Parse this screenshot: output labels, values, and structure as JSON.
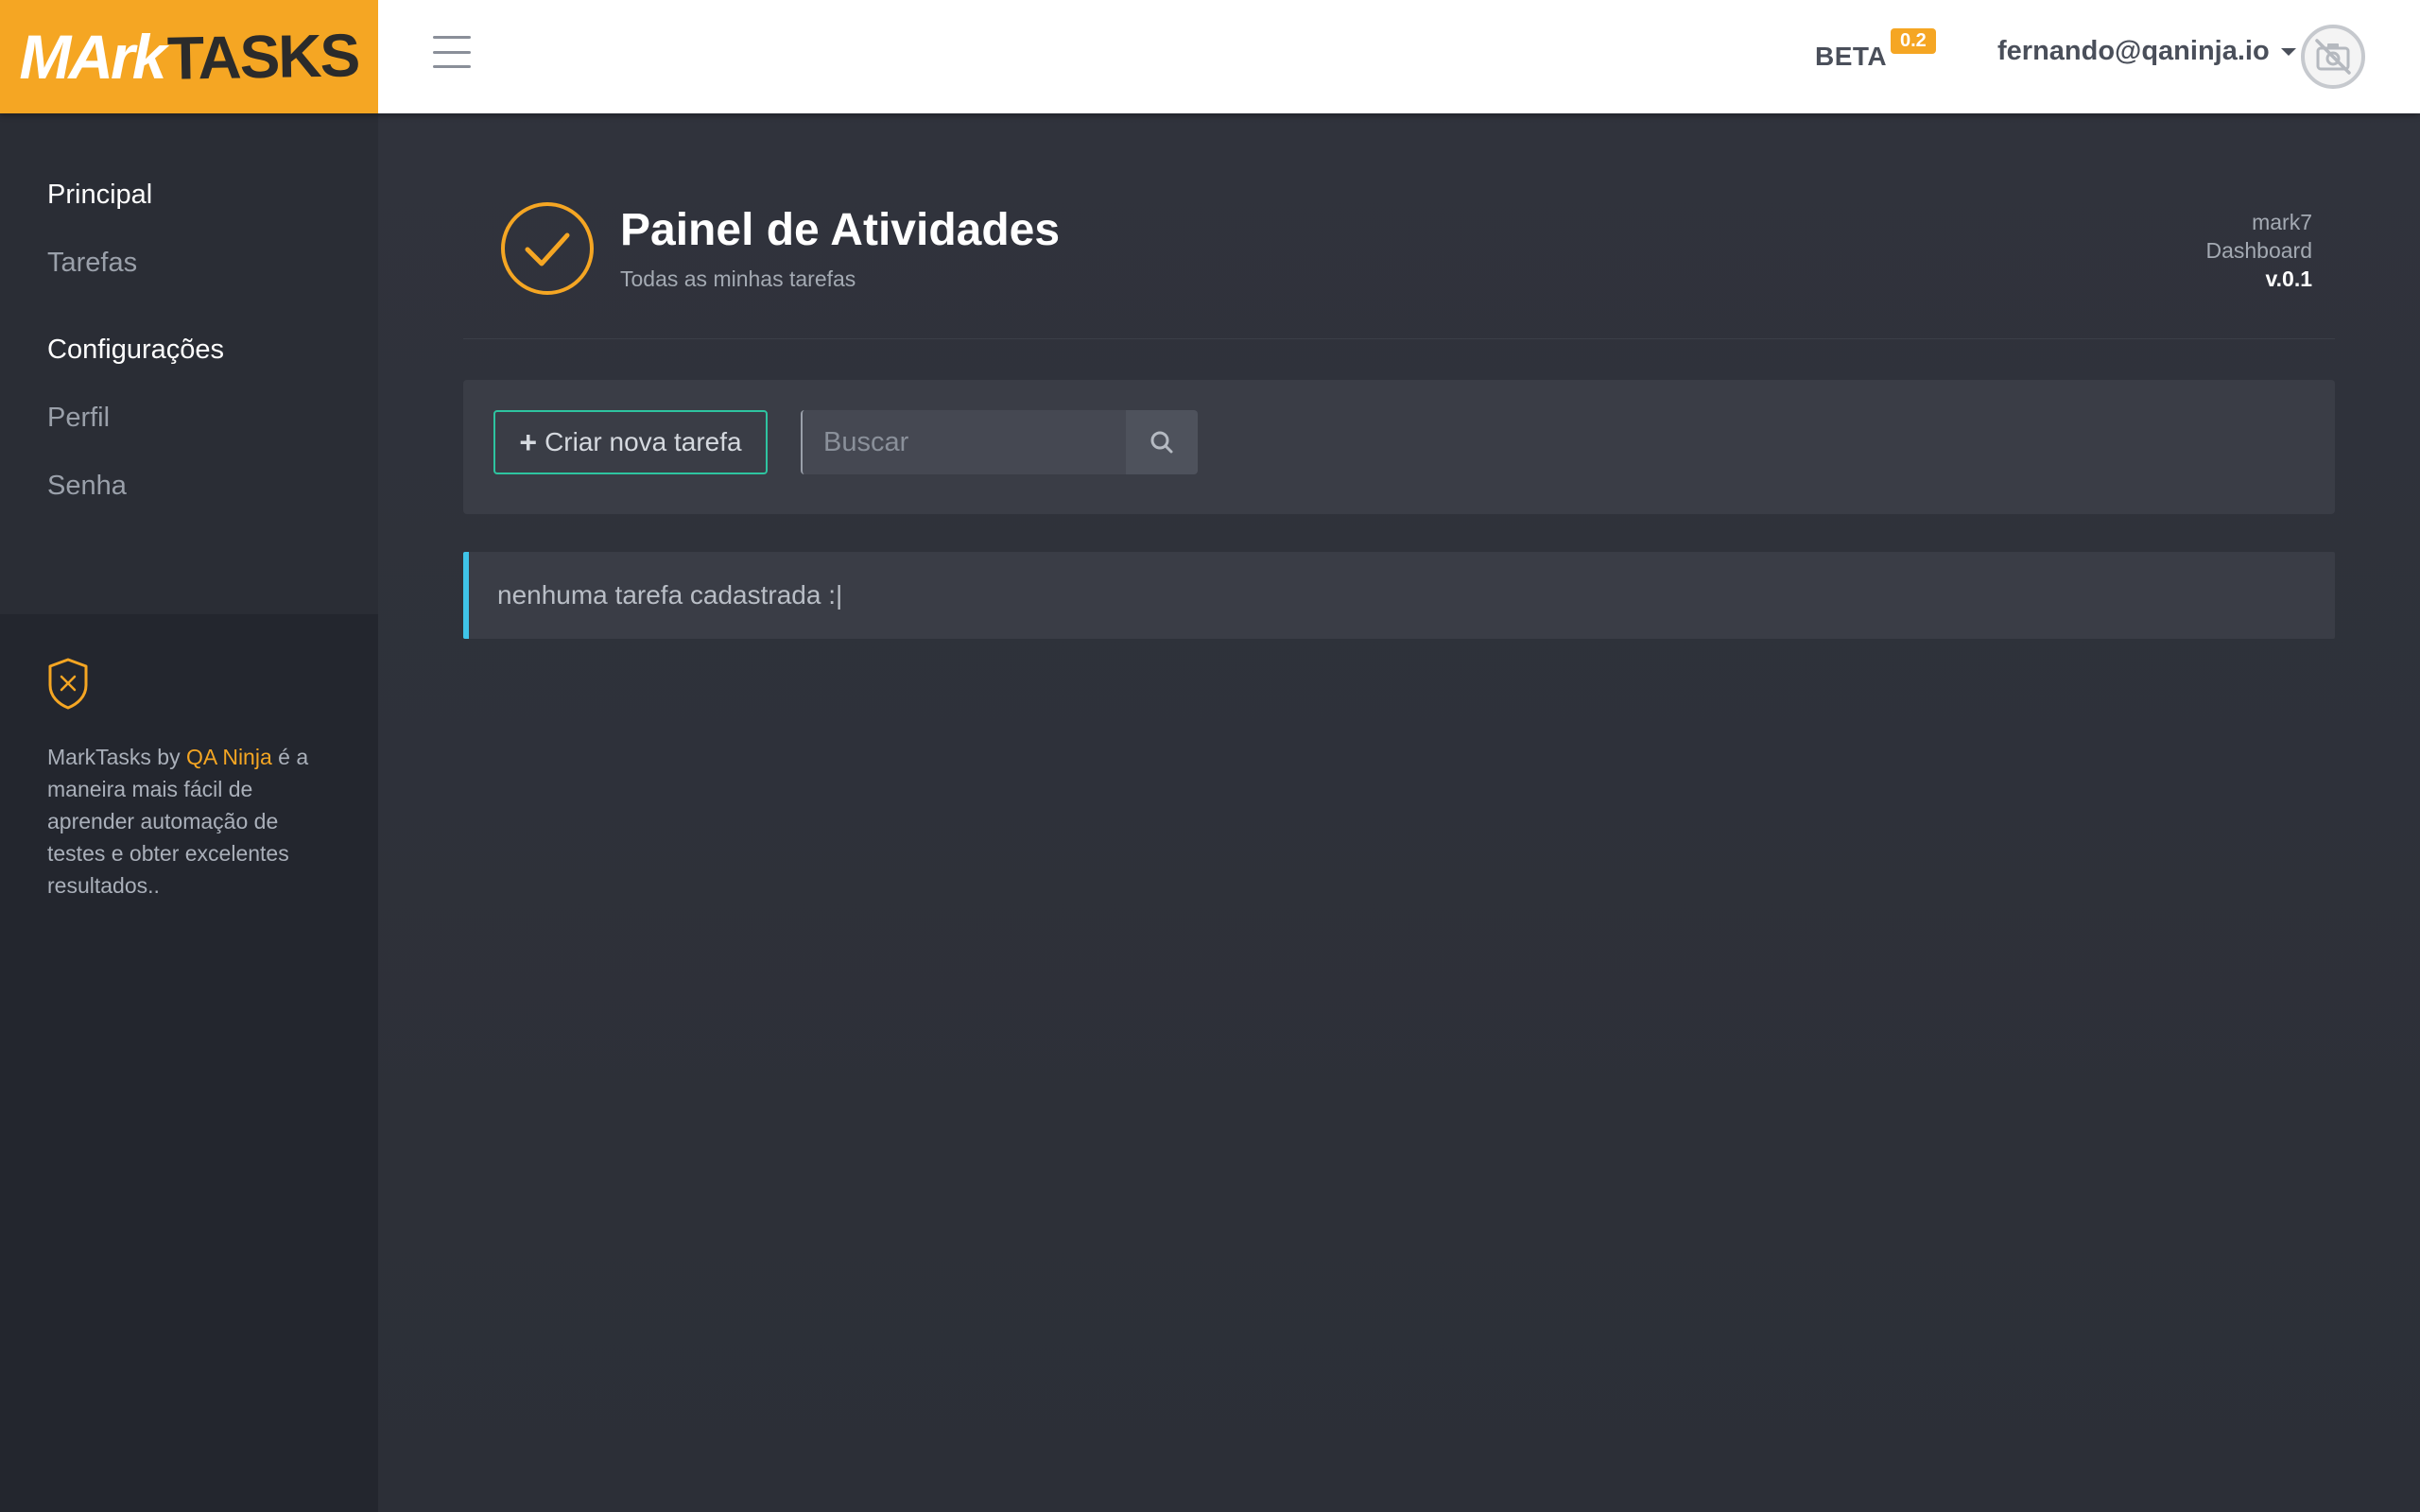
{
  "brand": {
    "logo_part1": "MArk",
    "logo_part2": "TASKS",
    "primary_color": "#f5a623"
  },
  "header": {
    "beta_label": "BETA",
    "beta_version": "0.2",
    "user_email": "fernando@qaninja.io",
    "avatar_icon": "no-camera-icon"
  },
  "sidebar": {
    "sections": [
      {
        "heading": "Principal",
        "items": [
          "Tarefas"
        ]
      },
      {
        "heading": "Configurações",
        "items": [
          "Perfil",
          "Senha"
        ]
      }
    ],
    "info": {
      "icon": "shield-x-icon",
      "text_before": "MarkTasks by ",
      "brand_link": "QA Ninja",
      "text_after": " é a maneira mais fácil de aprender automação de testes e obter excelentes resultados.."
    }
  },
  "page": {
    "icon": "check-circle-icon",
    "title": "Painel de Atividades",
    "subtitle": "Todas as minhas tarefas",
    "version_lines": [
      "mark7",
      "Dashboard",
      "v.0.1"
    ]
  },
  "toolbar": {
    "new_task_label": "Criar nova tarefa",
    "search_placeholder": "Buscar",
    "search_value": ""
  },
  "empty_message": "nenhuma tarefa cadastrada :|",
  "colors": {
    "accent_green": "#2ec4a0",
    "alert_blue": "#3fc4e8"
  }
}
